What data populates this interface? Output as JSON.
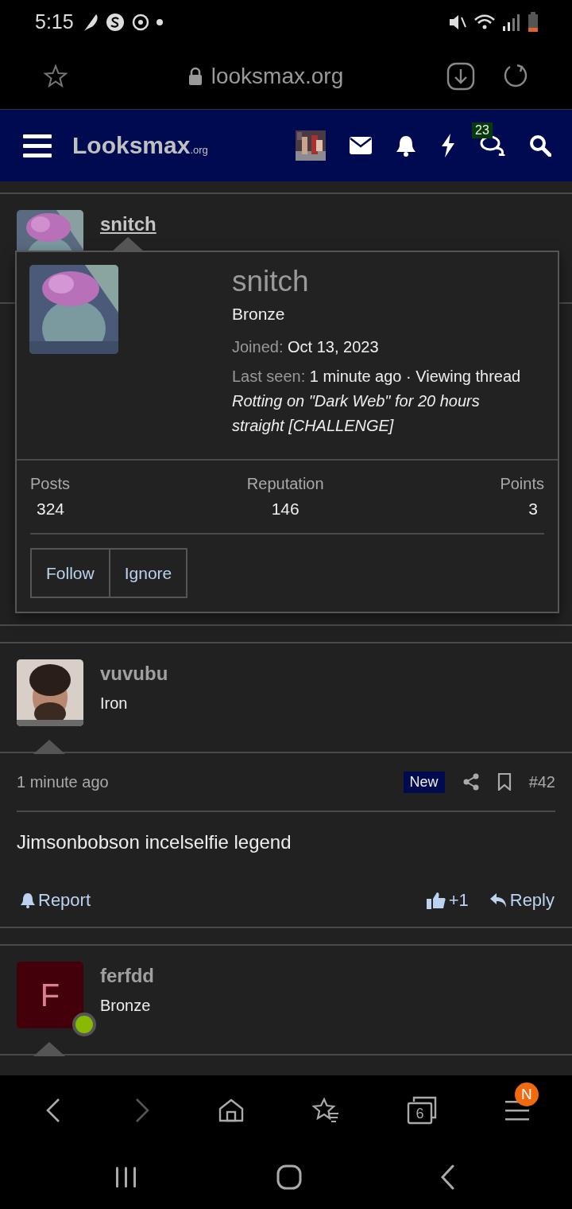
{
  "status_bar": {
    "time": "5:15"
  },
  "browser": {
    "url": "looksmax.org",
    "tab_count": "6",
    "menu_badge": "N",
    "forward_disabled": true
  },
  "site_nav": {
    "logo": "Looksmax",
    "logo_suffix": ".org",
    "unread_count": "23"
  },
  "posts": [
    {
      "username": "snitch",
      "underlined": true,
      "kind": "picture"
    },
    {
      "username": "vuvubu",
      "underlined": false,
      "rank": "Iron",
      "kind": "picture",
      "time": "1 minute ago",
      "new_label": "New",
      "number": "#42",
      "text": "Jimsonbobson incelselfie legend",
      "report": "Report",
      "reaction": "+1",
      "reply": "Reply"
    },
    {
      "username": "ferfdd",
      "underlined": false,
      "rank": "Bronze",
      "kind": "letter",
      "avatar_letter": "F",
      "online": true
    }
  ],
  "member_card": {
    "name": "snitch",
    "rank": "Bronze",
    "joined_label": "Joined:",
    "joined": "Oct 13, 2023",
    "last_seen_label": "Last seen:",
    "last_seen": "1 minute ago · Viewing thread *Rotting on \"Dark Web\" for 20 hours straight [CHALLENGE]*",
    "stats": [
      {
        "label": "Posts",
        "value": "324"
      },
      {
        "label": "Reputation",
        "value": "146"
      },
      {
        "label": "Points",
        "value": "3"
      }
    ],
    "buttons": [
      "Follow",
      "Ignore"
    ]
  }
}
